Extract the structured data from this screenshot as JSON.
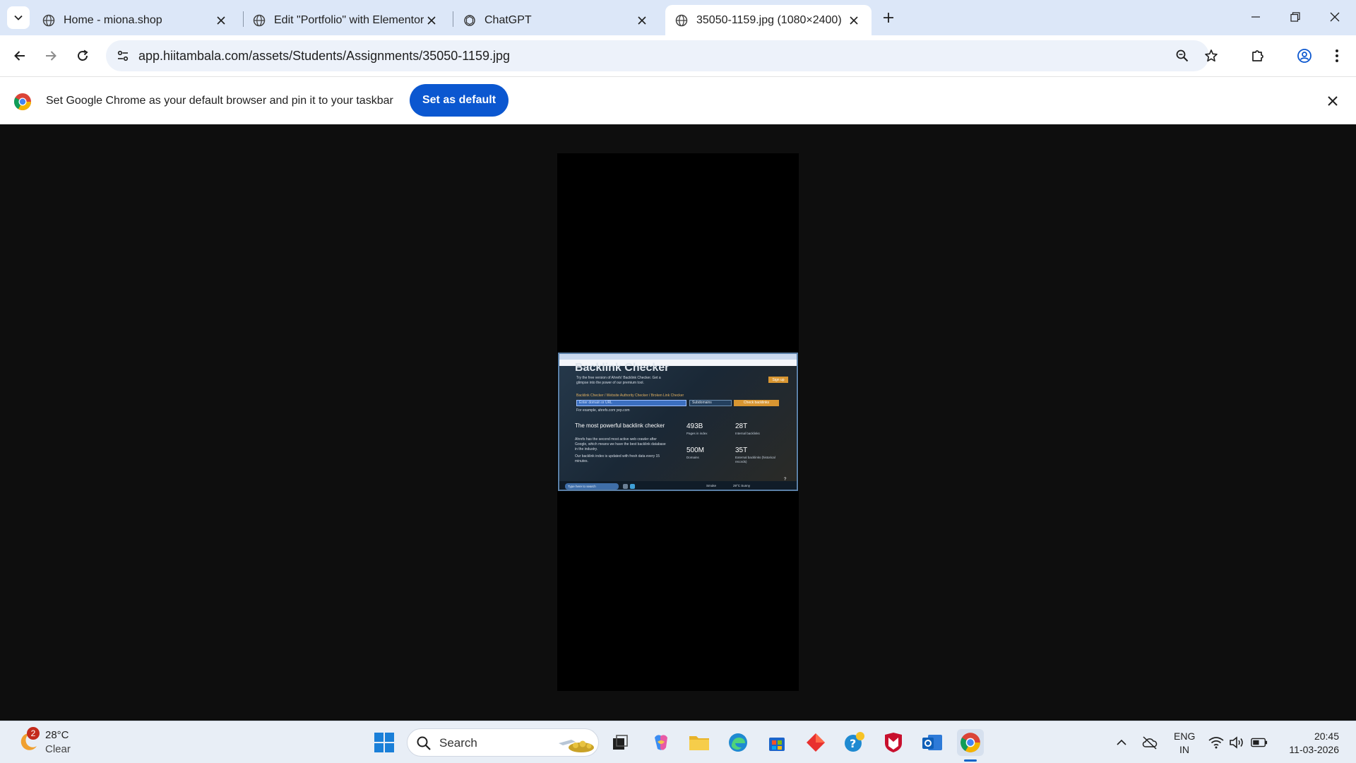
{
  "browser": {
    "tabs": [
      {
        "title": "Home - miona.shop",
        "active": false
      },
      {
        "title": "Edit \"Portfolio\" with Elementor",
        "active": false
      },
      {
        "title": "ChatGPT",
        "active": false
      },
      {
        "title": "35050-1159.jpg (1080×2400)",
        "active": true
      }
    ],
    "address_bar": {
      "url": "app.hiitambala.com/assets/Students/Assignments/35050-1159.jpg"
    },
    "infobar": {
      "message": "Set Google Chrome as your default browser and pin it to your taskbar",
      "button_label": "Set as default"
    }
  },
  "photo_content": {
    "heading": "Backlink Checker",
    "intro_line1": "Try the free version of Ahrefs' Backlink Checker. Get a",
    "intro_line2": "glimpse into the power of our premium tool.",
    "sign_in": "Sign up",
    "tool_links": "Backlink Checker / Website Authority Checker / Broken Link Checker",
    "input_placeholder": "Enter domain or URL",
    "select_value": "Subdomains",
    "check_button": "Check backlinks",
    "example": "For example, ahrefs.com yep.com",
    "section_title": "The most powerful backlink checker",
    "para1": "Ahrefs has the second most active web crawler after Google, which means we have the best backlink database in the industry.",
    "para2": "Our backlink index is updated with fresh data every 15 minutes.",
    "stats": [
      {
        "value": "493B",
        "label": "Pages in index"
      },
      {
        "value": "28T",
        "label": "Internal backlinks"
      },
      {
        "value": "500M",
        "label": "Domains"
      },
      {
        "value": "35T",
        "label": "External backlinks (historical records)"
      }
    ],
    "help": "?",
    "taskbar_search": "Type here to search",
    "taskbar_weather": "Smoke",
    "taskbar_sunny": "29°C Sunny"
  },
  "taskbar": {
    "weather": {
      "temperature": "28°C",
      "condition": "Clear",
      "badge": "2"
    },
    "search_placeholder": "Search",
    "tray": {
      "language_line1": "ENG",
      "language_line2": "IN",
      "time": "20:45",
      "date": "11-03-2026"
    }
  },
  "colors": {
    "accent": "#0b57d0",
    "tab_strip": "#dce7f8",
    "content_bg": "#0e0e0e"
  }
}
